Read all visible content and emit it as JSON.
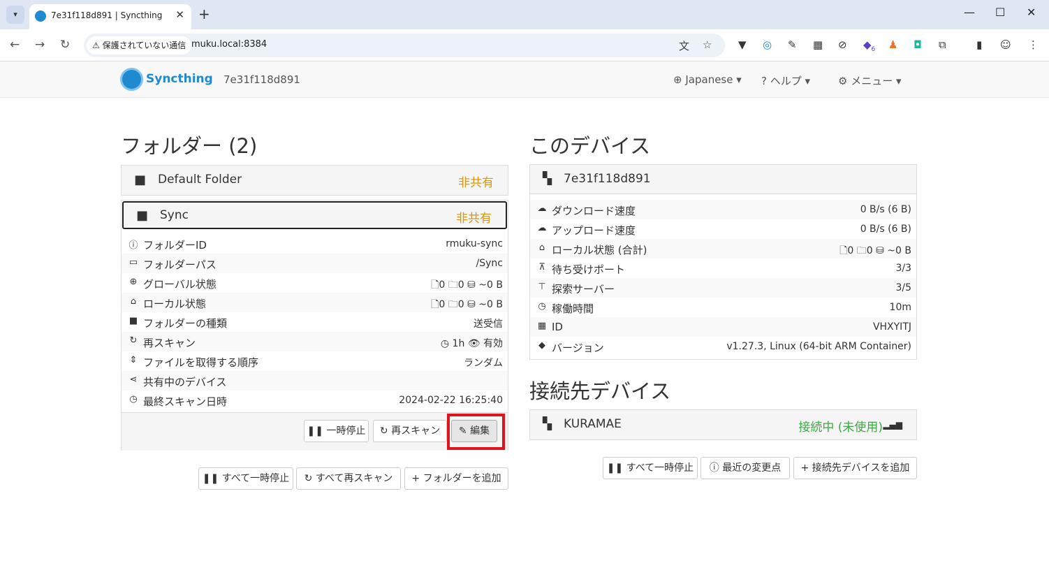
{
  "browser": {
    "tab_title": "7e31f118d891 | Syncthing",
    "security_chip": "保護されていない通信",
    "url": "muku.local:8384",
    "badge_count": "6"
  },
  "navbar": {
    "brand": "Syncthing",
    "device": "7e31f118d891",
    "language": "Japanese",
    "help": "ヘルプ",
    "menu": "メニュー"
  },
  "folders": {
    "heading": "フォルダー (2)",
    "default_folder": {
      "name": "Default Folder",
      "status": "非共有"
    },
    "sync": {
      "name": "Sync",
      "status": "非共有",
      "rows": [
        {
          "label": "フォルダーID",
          "value": "rmuku-sync"
        },
        {
          "label": "フォルダーパス",
          "value": "/Sync"
        },
        {
          "label": "グローバル状態",
          "value": "🗋0  🗀0  ⛁ ~0 B"
        },
        {
          "label": "ローカル状態",
          "value": "🗋0  🗀0  ⛁ ~0 B"
        },
        {
          "label": "フォルダーの種類",
          "value": "送受信"
        },
        {
          "label": "再スキャン",
          "value": "◷ 1h  👁 有効"
        },
        {
          "label": "ファイルを取得する順序",
          "value": "ランダム"
        },
        {
          "label": "共有中のデバイス",
          "value": ""
        },
        {
          "label": "最終スキャン日時",
          "value": "2024-02-22 16:25:40"
        }
      ],
      "buttons": {
        "pause": "一時停止",
        "rescan": "再スキャン",
        "edit": "編集"
      }
    },
    "bottom_buttons": {
      "pause_all": "すべて一時停止",
      "rescan_all": "すべて再スキャン",
      "add_folder": "フォルダーを追加"
    }
  },
  "this_device": {
    "heading": "このデバイス",
    "name": "7e31f118d891",
    "rows": [
      {
        "label": "ダウンロード速度",
        "value": "0 B/s (6 B)"
      },
      {
        "label": "アップロード速度",
        "value": "0 B/s (6 B)"
      },
      {
        "label": "ローカル状態 (合計)",
        "value": "🗋0  🗀0  ⛁ ~0 B"
      },
      {
        "label": "待ち受けポート",
        "value": "3/3"
      },
      {
        "label": "探索サーバー",
        "value": "3/5"
      },
      {
        "label": "稼働時間",
        "value": "10m"
      },
      {
        "label": "ID",
        "value": "VHXYITJ"
      },
      {
        "label": "バージョン",
        "value": "v1.27.3, Linux (64-bit ARM Container)"
      }
    ]
  },
  "remote_devices": {
    "heading": "接続先デバイス",
    "device": {
      "name": "KURAMAE",
      "status": "接続中 (未使用)"
    },
    "buttons": {
      "pause_all": "すべて一時停止",
      "recent_changes": "最近の変更点",
      "add_device": "接続先デバイスを追加"
    }
  }
}
